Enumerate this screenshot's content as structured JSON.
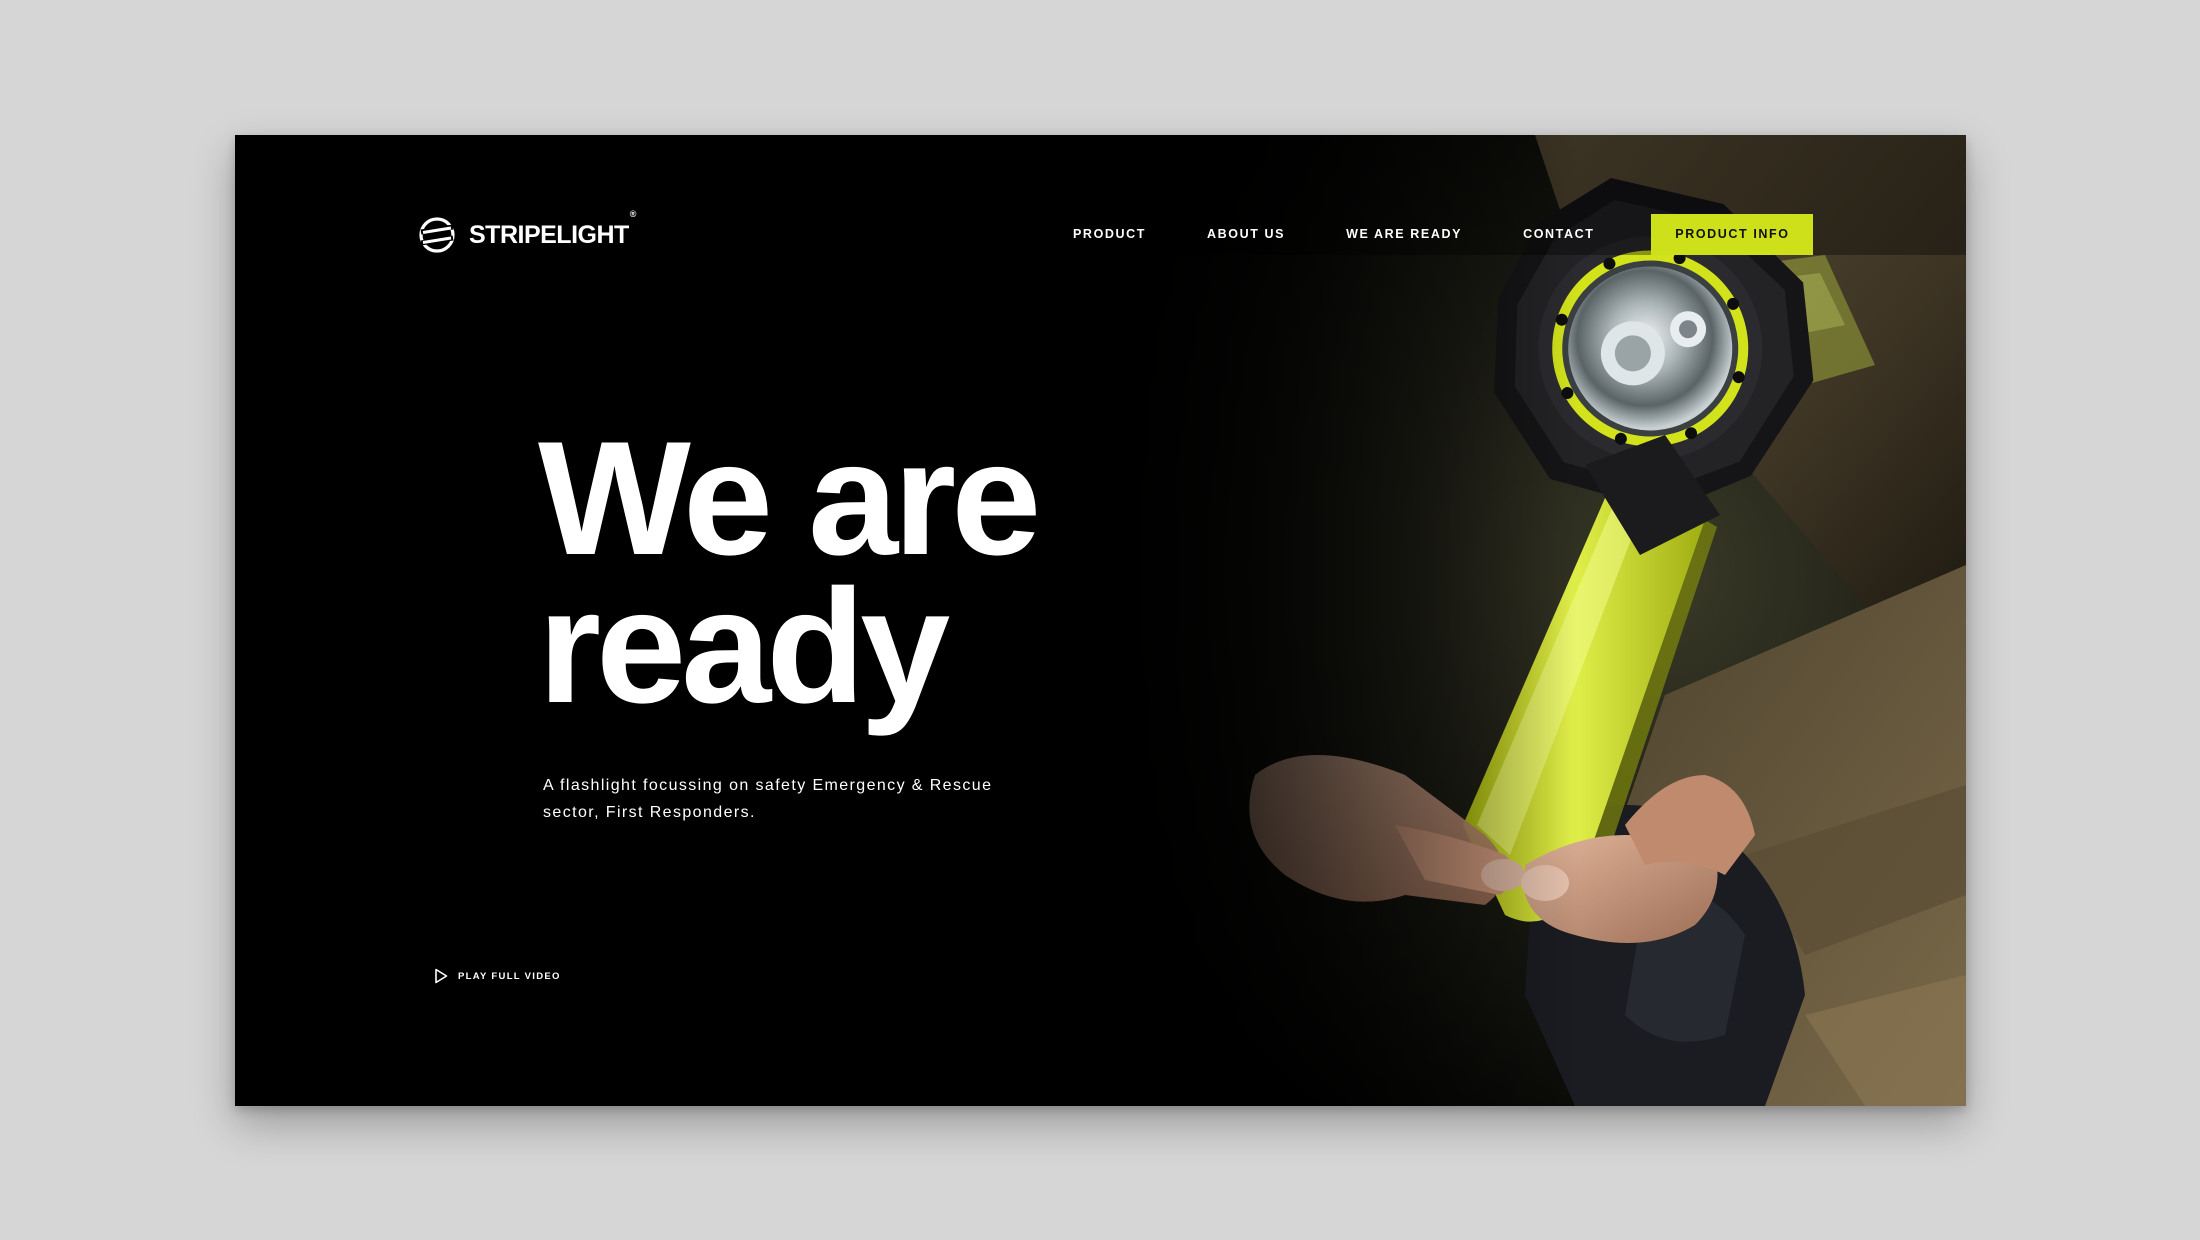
{
  "brand": {
    "name": "STRIPELIGHT",
    "registered_mark": "®",
    "logo_icon": "stripelight-logo-icon"
  },
  "nav": {
    "items": [
      {
        "label": "PRODUCT"
      },
      {
        "label": "ABOUT US"
      },
      {
        "label": "WE ARE READY"
      },
      {
        "label": "CONTACT"
      }
    ],
    "cta_label": "PRODUCT INFO"
  },
  "hero": {
    "headline_line1": "We are",
    "headline_line2": "ready",
    "subcopy": "A flashlight focussing on safety Emergency & Rescue sector, First Responders.",
    "play_label": "PLAY FULL VIDEO",
    "play_icon": "play-icon",
    "image_subject": "hero-photo"
  },
  "colors": {
    "page_background": "#d6d6d6",
    "frame_background": "#000000",
    "accent": "#cde01a",
    "text": "#ffffff"
  }
}
